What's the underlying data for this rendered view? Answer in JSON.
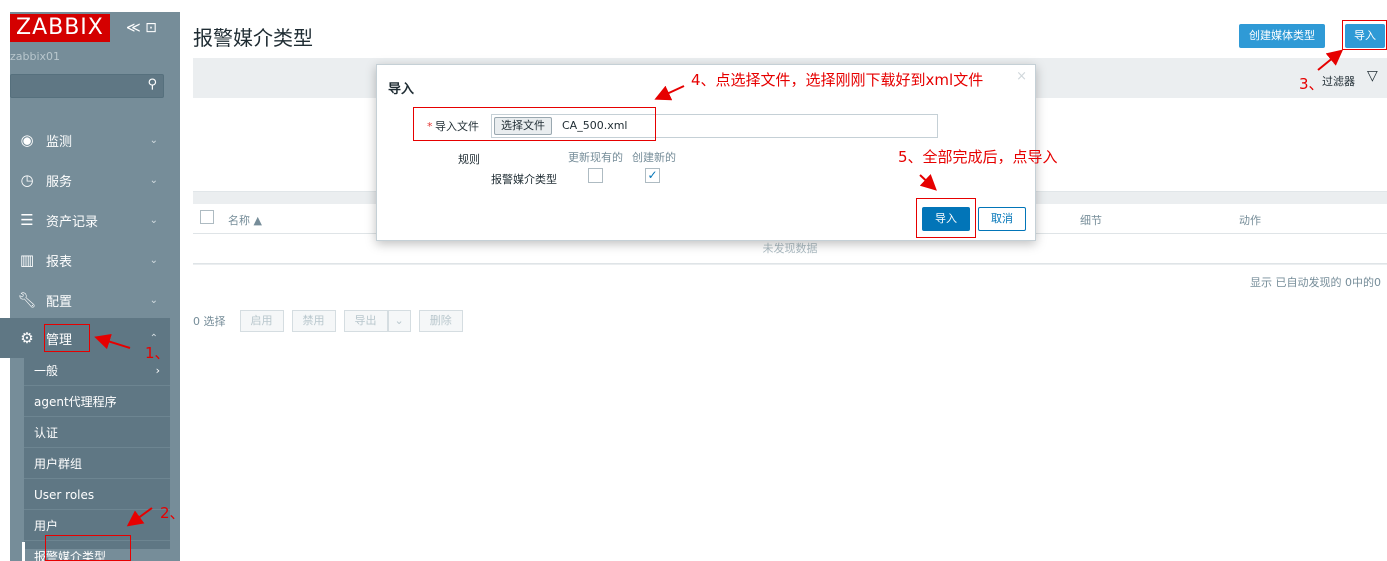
{
  "app": {
    "logo": "ZABBIX",
    "logo_controls": "≪ ⊡",
    "hostname": "zabbix01"
  },
  "sidebar": {
    "search_placeholder": "",
    "items": [
      {
        "label": "监测",
        "icon": "eye-icon"
      },
      {
        "label": "服务",
        "icon": "clock-icon"
      },
      {
        "label": "资产记录",
        "icon": "list-icon"
      },
      {
        "label": "报表",
        "icon": "bar-chart-icon"
      },
      {
        "label": "配置",
        "icon": "wrench-icon"
      },
      {
        "label": "管理",
        "icon": "gear-icon"
      }
    ],
    "submenu": [
      {
        "label": "一般"
      },
      {
        "label": "agent代理程序"
      },
      {
        "label": "认证"
      },
      {
        "label": "用户群组"
      },
      {
        "label": "User roles"
      },
      {
        "label": "用户"
      },
      {
        "label": "报警媒介类型"
      }
    ]
  },
  "header": {
    "title": "报警媒介类型",
    "create_button": "创建媒体类型",
    "import_button": "导入"
  },
  "filter": {
    "label": "过滤器"
  },
  "table": {
    "columns": [
      "名称 ▲",
      "细节",
      "动作"
    ],
    "empty_text": "未发现数据",
    "summary": "显示 已自动发现的 0中的0"
  },
  "actions": {
    "selected": "0 选择",
    "enable": "启用",
    "disable": "禁用",
    "export": "导出",
    "delete": "删除"
  },
  "modal": {
    "title": "导入",
    "close": "×",
    "file_label": "导入文件",
    "file_button": "选择文件",
    "file_name": "CA_500.xml",
    "rules_label": "规则",
    "col_update": "更新现有的",
    "col_create": "创建新的",
    "row_label": "报警媒介类型",
    "update_checked": false,
    "create_checked": true,
    "import_button": "导入",
    "cancel_button": "取消"
  },
  "annotations": {
    "step1": "1、",
    "step2": "2、",
    "step3": "3、",
    "step4": "4、点选择文件，选择刚刚下载好到xml文件",
    "step5": "5、全部完成后，点导入"
  },
  "colors": {
    "sidebar": "#768d99",
    "accent": "#0275b8",
    "logo": "#d40000",
    "annotation": "#e60000"
  }
}
